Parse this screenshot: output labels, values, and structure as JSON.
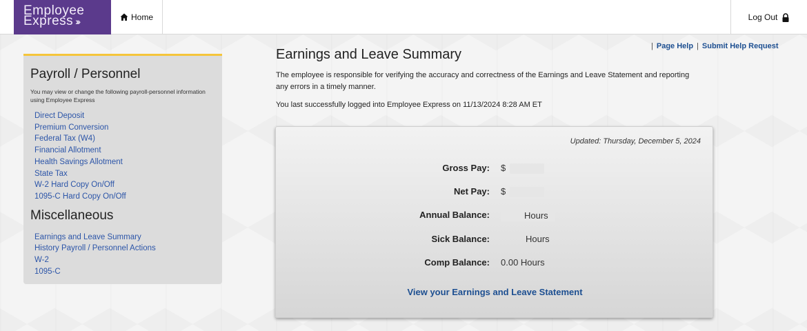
{
  "header": {
    "logo_line1": "Employee",
    "logo_line2": "Express",
    "logo_arrows": "›››",
    "home_label": "Home",
    "logout_label": "Log Out"
  },
  "sidebar": {
    "section1_title": "Payroll / Personnel",
    "intro": "You may view or change the following payroll-personnel information using Employee Express",
    "payroll_items": [
      {
        "label": "Direct Deposit"
      },
      {
        "label": "Premium Conversion"
      },
      {
        "label": "Federal Tax (W4)"
      },
      {
        "label": "Financial Allotment"
      },
      {
        "label": "Health Savings Allotment"
      },
      {
        "label": "State Tax"
      },
      {
        "label": "W-2 Hard Copy On/Off"
      },
      {
        "label": "1095-C Hard Copy On/Off"
      }
    ],
    "section2_title": "Miscellaneous",
    "misc_items": [
      {
        "label": "Earnings and Leave Summary"
      },
      {
        "label": "History Payroll / Personnel Actions"
      },
      {
        "label": "W-2"
      },
      {
        "label": "1095-C"
      }
    ]
  },
  "help": {
    "sep": "|",
    "page_help": "Page Help",
    "submit_help": "Submit Help Request"
  },
  "main": {
    "title": "Earnings and Leave Summary",
    "description": "The employee is responsible for verifying the accuracy and correctness of the Earnings and Leave Statement and reporting any errors in a timely manner.",
    "last_login": "You last successfully logged into Employee Express on 11/13/2024 8:28 AM ET"
  },
  "summary": {
    "updated": "Updated: Thursday, December 5, 2024",
    "gross_pay_label": "Gross Pay:",
    "gross_pay_value": "$",
    "net_pay_label": "Net Pay:",
    "net_pay_value": "$",
    "annual_label": "Annual Balance:",
    "annual_value": "Hours",
    "sick_label": "Sick Balance:",
    "sick_value": "Hours",
    "comp_label": "Comp Balance:",
    "comp_value": "0.00 Hours",
    "statement_link": "View your Earnings and Leave Statement"
  }
}
